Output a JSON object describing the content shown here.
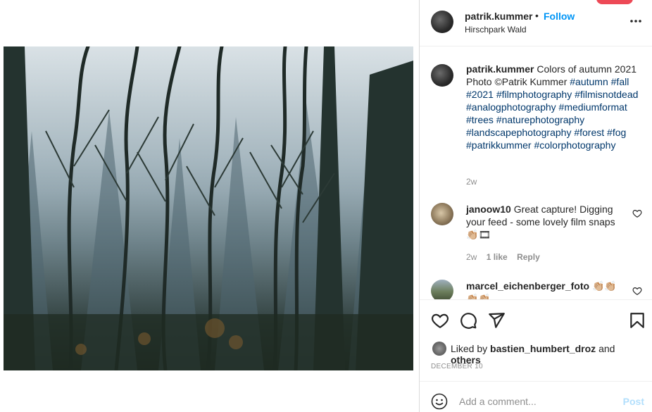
{
  "header": {
    "username": "patrik.kummer",
    "separator": "•",
    "follow_label": "Follow",
    "location": "Hirschpark Wald",
    "more_icon": "more-horizontal-icon"
  },
  "caption": {
    "username": "patrik.kummer",
    "text": "Colors of autumn 2021 Photo ©Patrik Kummer",
    "hashtags": "#autumn #fall #2021 #filmphotography #filmisnotdead #analogphotography #mediumformat #trees #naturephotography #landscapephotography #forest #fog #patrikkummer #colorphotography",
    "time": "2w"
  },
  "comments": [
    {
      "username": "janoow10",
      "text": "Great capture! Digging your feed - some lovely film snaps 👏🏼🎞",
      "time": "2w",
      "likes": "1 like",
      "reply_label": "Reply"
    },
    {
      "username": "marcel_eichenberger_foto",
      "text": "👏🏼👏🏼👏🏼👏🏼"
    }
  ],
  "actions": {
    "icons": [
      "heart-icon",
      "comment-icon",
      "share-icon",
      "bookmark-icon"
    ]
  },
  "likes": {
    "prefix": "Liked by",
    "user": "bastien_humbert_droz",
    "middle": "and",
    "others": "others"
  },
  "date": "DECEMBER 10",
  "add_comment": {
    "placeholder": "Add a comment...",
    "post_label": "Post"
  },
  "colors": {
    "link_blue": "#0095f6",
    "post_disabled": "#b2dffc",
    "hashtag": "#00376b",
    "muted": "#8e8e8e"
  }
}
